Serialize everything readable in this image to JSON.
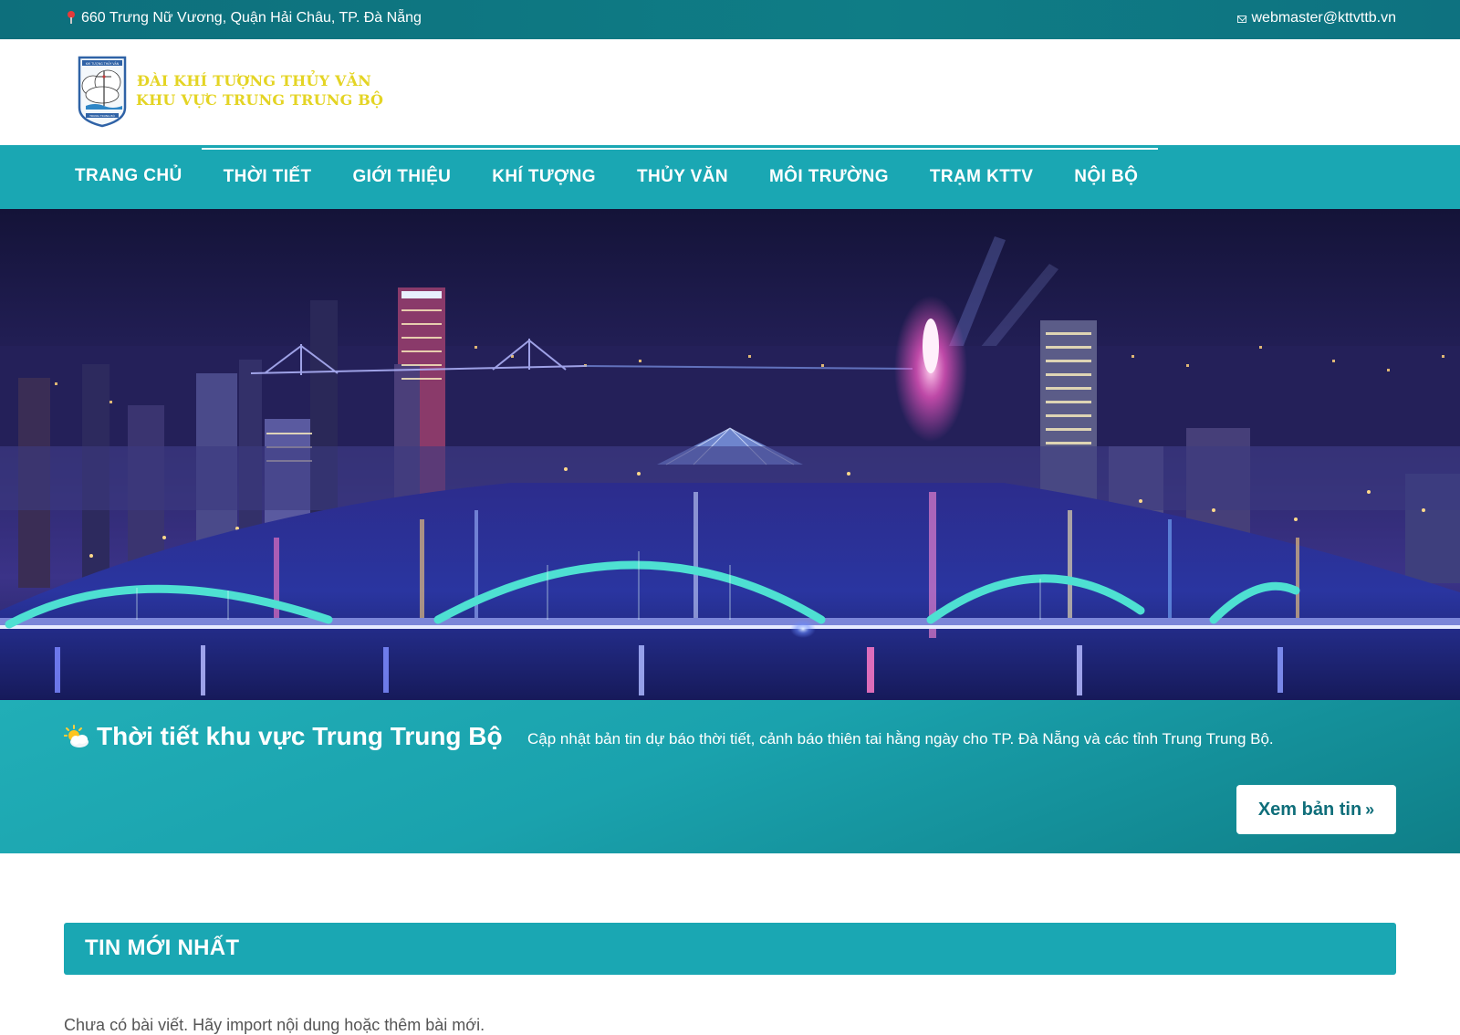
{
  "topbar": {
    "address": "660 Trưng Nữ Vương, Quận Hải Châu, TP. Đà Nẵng",
    "email": "webmaster@kttvttb.vn"
  },
  "brand": {
    "line1": "ĐÀI KHÍ TƯỢNG THỦY VĂN",
    "line2": "KHU VỰC TRUNG TRUNG BỘ",
    "logo_top_text": "KHÍ TƯỢNG THỦY VĂN",
    "logo_bottom_text": "TRUNG TRUNG BỘ",
    "color": "#e4d424"
  },
  "nav": {
    "items": [
      {
        "label": "TRANG CHỦ"
      },
      {
        "label": "THỜI TIẾT"
      },
      {
        "label": "GIỚI THIỆU"
      },
      {
        "label": "KHÍ TƯỢNG"
      },
      {
        "label": "THỦY VĂN"
      },
      {
        "label": "MÔI TRƯỜNG"
      },
      {
        "label": "TRẠM KTTV"
      },
      {
        "label": "NỘI BỘ"
      }
    ],
    "background": "#1aa7b3"
  },
  "hero": {
    "icon": "city-night-image"
  },
  "weather": {
    "title": "Thời tiết khu vực Trung Trung Bộ",
    "description": "Cập nhật bản tin dự báo thời tiết, cảnh báo thiên tai hằng ngày cho TP. Đà Nẵng và các tỉnh Trung Trung Bộ.",
    "button_label": "Xem bản tin",
    "button_suffix": "»",
    "icon": "sun-cloud-icon"
  },
  "news": {
    "heading": "TIN MỚI NHẤT",
    "empty_message": "Chưa có bài viết. Hãy import nội dung hoặc thêm bài mới."
  },
  "colors": {
    "teal": "#1aa7b3",
    "dark_teal": "#0d6f7c",
    "button_text": "#0f6e7a"
  }
}
